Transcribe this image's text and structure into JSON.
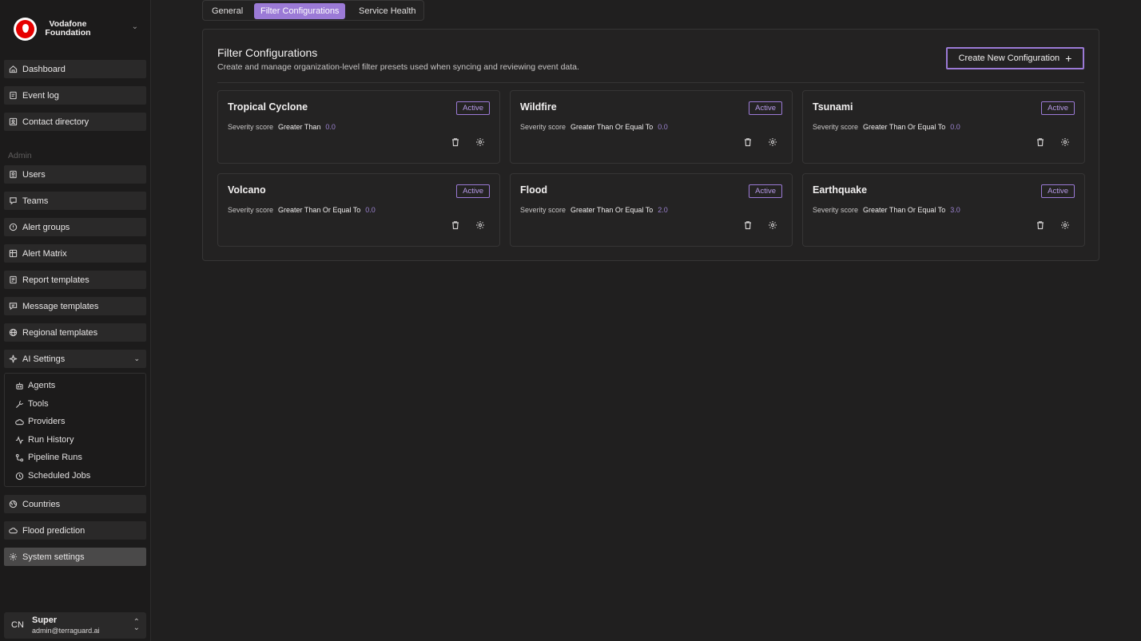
{
  "org": {
    "name": "Vodafone Foundation"
  },
  "nav": {
    "items": [
      {
        "label": "Dashboard",
        "icon": "home-icon"
      },
      {
        "label": "Event log",
        "icon": "event-log-icon"
      },
      {
        "label": "Contact directory",
        "icon": "contact-directory-icon"
      }
    ],
    "admin_label": "Admin",
    "admin_items": [
      {
        "label": "Users",
        "icon": "users-icon"
      },
      {
        "label": "Teams",
        "icon": "teams-icon"
      },
      {
        "label": "Alert groups",
        "icon": "alert-groups-icon"
      },
      {
        "label": "Alert Matrix",
        "icon": "alert-matrix-icon"
      },
      {
        "label": "Report templates",
        "icon": "report-templates-icon"
      },
      {
        "label": "Message templates",
        "icon": "message-templates-icon"
      },
      {
        "label": "Regional templates",
        "icon": "globe-icon"
      },
      {
        "label": "AI Settings",
        "icon": "ai-sparkle-icon"
      }
    ],
    "ai_sub_items": [
      {
        "label": "Agents",
        "icon": "robot-icon"
      },
      {
        "label": "Tools",
        "icon": "wrench-icon"
      },
      {
        "label": "Providers",
        "icon": "cloud-icon"
      },
      {
        "label": "Run History",
        "icon": "activity-icon"
      },
      {
        "label": "Pipeline Runs",
        "icon": "pipeline-icon"
      },
      {
        "label": "Scheduled Jobs",
        "icon": "clock-icon"
      }
    ],
    "bottom_items": [
      {
        "label": "Countries",
        "icon": "globe-icon"
      },
      {
        "label": "Flood prediction",
        "icon": "cloud-icon"
      },
      {
        "label": "System settings",
        "icon": "gear-icon"
      }
    ]
  },
  "user": {
    "initials": "CN",
    "name": "Super",
    "email": "admin@terraguard.ai"
  },
  "tabs": [
    "General",
    "Filter Configurations",
    "Service Health"
  ],
  "active_tab": "Filter Configurations",
  "panel": {
    "title": "Filter Configurations",
    "description": "Create and manage organization-level filter presets used when syncing and reviewing event data.",
    "create_label": "Create New Configuration"
  },
  "configs": [
    {
      "title": "Tropical Cyclone",
      "status": "Active",
      "label": "Severity score",
      "operator": "Greater Than",
      "value": "0.0"
    },
    {
      "title": "Wildfire",
      "status": "Active",
      "label": "Severity score",
      "operator": "Greater Than Or Equal To",
      "value": "0.0"
    },
    {
      "title": "Tsunami",
      "status": "Active",
      "label": "Severity score",
      "operator": "Greater Than Or Equal To",
      "value": "0.0"
    },
    {
      "title": "Volcano",
      "status": "Active",
      "label": "Severity score",
      "operator": "Greater Than Or Equal To",
      "value": "0.0"
    },
    {
      "title": "Flood",
      "status": "Active",
      "label": "Severity score",
      "operator": "Greater Than Or Equal To",
      "value": "2.0"
    },
    {
      "title": "Earthquake",
      "status": "Active",
      "label": "Severity score",
      "operator": "Greater Than Or Equal To",
      "value": "3.0"
    }
  ],
  "colors": {
    "accent": "#9b7ad6",
    "background": "#201f1f",
    "sidebar": "#1c1b1b"
  }
}
